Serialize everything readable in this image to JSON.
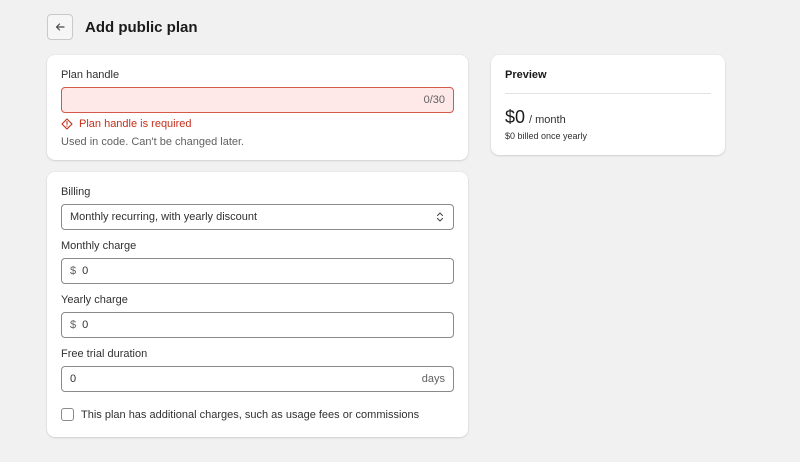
{
  "header": {
    "title": "Add public plan",
    "back_icon": "arrow-left-icon"
  },
  "plan_handle": {
    "label": "Plan handle",
    "value": "",
    "counter": "0/30",
    "error": "Plan handle is required",
    "error_icon": "alert-diamond-icon",
    "help": "Used in code. Can't be changed later."
  },
  "billing": {
    "label": "Billing",
    "selected": "Monthly recurring, with yearly discount",
    "select_icon": "select-chevron-icon"
  },
  "monthly_charge": {
    "label": "Monthly charge",
    "prefix": "$",
    "value": "0"
  },
  "yearly_charge": {
    "label": "Yearly charge",
    "prefix": "$",
    "value": "0"
  },
  "free_trial": {
    "label": "Free trial duration",
    "value": "0",
    "suffix": "days"
  },
  "additional_charges": {
    "label": "This plan has additional charges, such as usage fees or commissions",
    "checked": false
  },
  "preview": {
    "title": "Preview",
    "price": "$0",
    "period": "/ month",
    "note": "$0 billed once yearly"
  },
  "colors": {
    "error_bg": "#fee9e8",
    "error_border": "#d4594a",
    "error_text": "#c4301c",
    "page_bg": "#f1f1f1"
  }
}
